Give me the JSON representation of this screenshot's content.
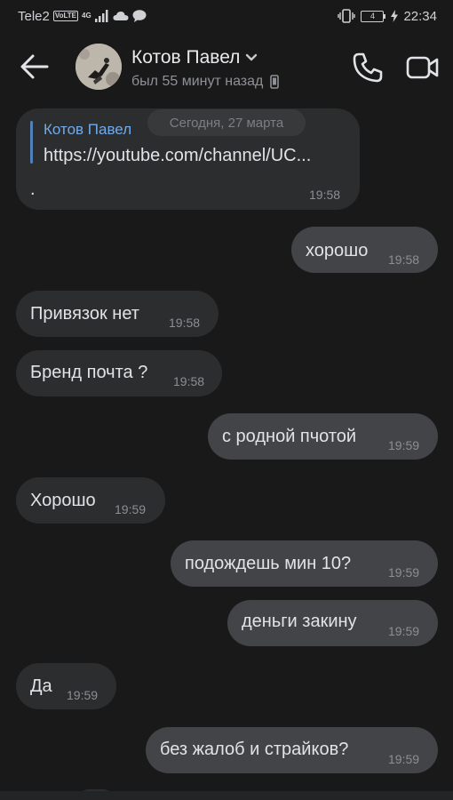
{
  "status_bar": {
    "carrier": "Tele2",
    "volte": "VoLTE",
    "network": "4G",
    "battery": "4",
    "time": "22:34"
  },
  "header": {
    "name": "Котов Павел",
    "status": "был 55 минут назад"
  },
  "date_separator": "Сегодня, 27 марта",
  "messages": [
    {
      "direction": "in",
      "reply_author": "Котов Павел",
      "link": "https://youtube.com/channel/UC...",
      "text": ".",
      "time": "19:58"
    },
    {
      "direction": "out",
      "text": "хорошо",
      "time": "19:58"
    },
    {
      "direction": "in",
      "text": "Привязок нет",
      "time": "19:58"
    },
    {
      "direction": "in",
      "text": "Бренд почта ?",
      "time": "19:58"
    },
    {
      "direction": "out",
      "text": "с родной пчотой",
      "time": "19:59"
    },
    {
      "direction": "in",
      "text": "Хорошо",
      "time": "19:59"
    },
    {
      "direction": "out",
      "text": "подождешь мин 10?",
      "time": "19:59"
    },
    {
      "direction": "out",
      "text": "деньги закину",
      "time": "19:59"
    },
    {
      "direction": "in",
      "text": "Да",
      "time": "19:59"
    },
    {
      "direction": "out",
      "text": "без жалоб и страйков?",
      "time": "19:59"
    }
  ]
}
